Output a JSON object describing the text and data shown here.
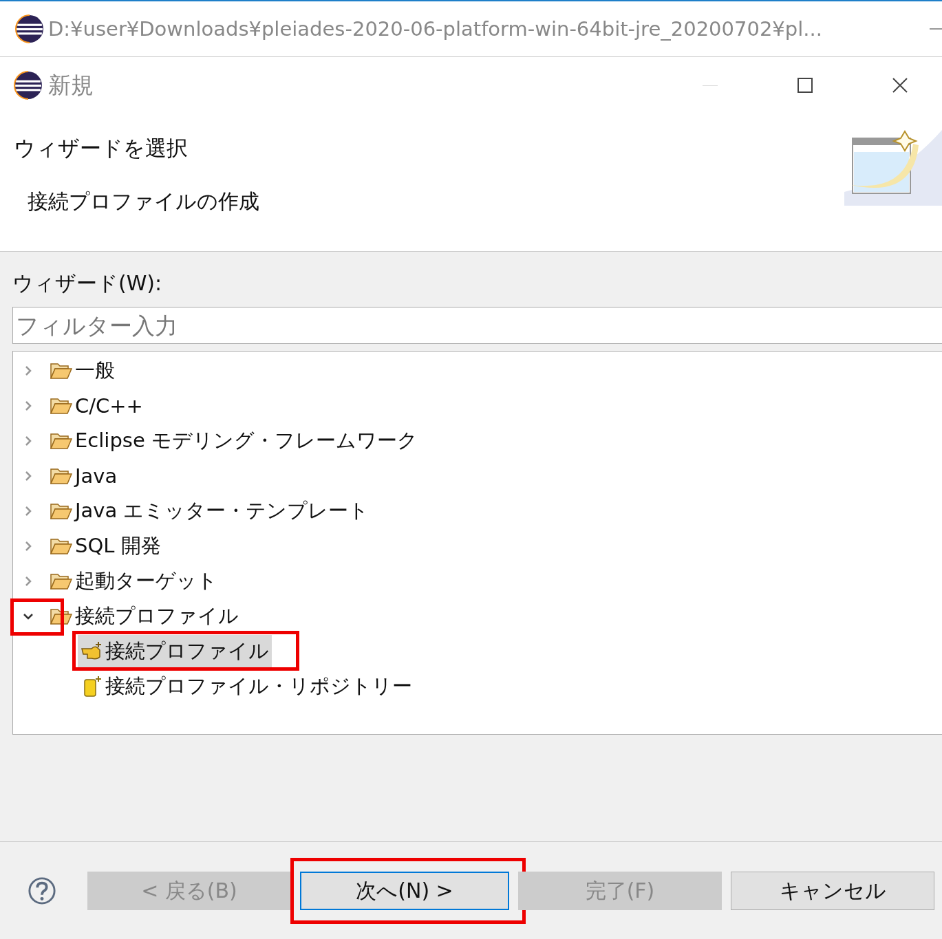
{
  "app_window": {
    "title": "D:¥user¥Downloads¥pleiades-2020-06-platform-win-64bit-jre_20200702¥pl..."
  },
  "dialog": {
    "title": "新規"
  },
  "header": {
    "title": "ウィザードを選択",
    "description": "接続プロファイルの作成"
  },
  "wizard_label": "ウィザード(W):",
  "filter": {
    "placeholder": "フィルター入力"
  },
  "tree": [
    {
      "label": "一般",
      "kind": "folder",
      "expanded": false,
      "annotated": false
    },
    {
      "label": "C/C++",
      "kind": "folder",
      "expanded": false,
      "annotated": false
    },
    {
      "label": "Eclipse モデリング・フレームワーク",
      "kind": "folder",
      "expanded": false,
      "annotated": false
    },
    {
      "label": "Java",
      "kind": "folder",
      "expanded": false,
      "annotated": false
    },
    {
      "label": "Java エミッター・テンプレート",
      "kind": "folder",
      "expanded": false,
      "annotated": false
    },
    {
      "label": "SQL 開発",
      "kind": "folder",
      "expanded": false,
      "annotated": false
    },
    {
      "label": "起動ターゲット",
      "kind": "folder",
      "expanded": false,
      "annotated": false
    },
    {
      "label": "接続プロファイル",
      "kind": "folder",
      "expanded": true,
      "annotated": true,
      "children": [
        {
          "label": "接続プロファイル",
          "kind": "wizard",
          "selected": true,
          "annotated": true
        },
        {
          "label": "接続プロファイル・リポジトリー",
          "kind": "repository",
          "selected": false,
          "annotated": false
        }
      ]
    }
  ],
  "buttons": [
    {
      "label": "< 戻る(B)",
      "disabled": true,
      "default": false,
      "annotated": false
    },
    {
      "label": "次へ(N) >",
      "disabled": false,
      "default": true,
      "annotated": true
    },
    {
      "label": "完了(F)",
      "disabled": true,
      "default": false,
      "annotated": false
    },
    {
      "label": "キャンセル",
      "disabled": false,
      "default": false,
      "annotated": false
    }
  ]
}
